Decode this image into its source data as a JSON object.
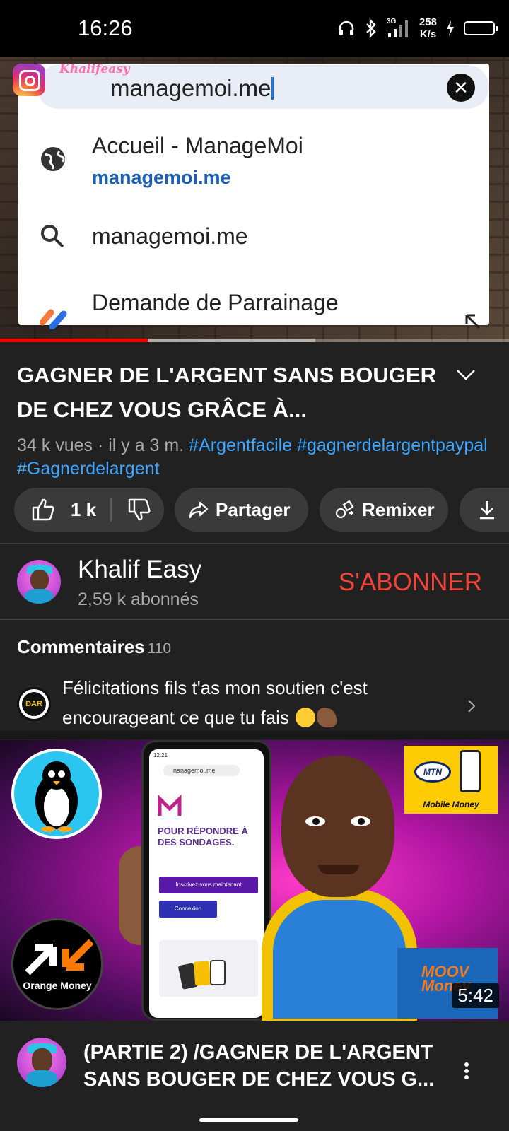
{
  "status_bar": {
    "time": "16:26",
    "network": "3G",
    "speed_value": "258",
    "speed_unit": "K/s",
    "icons": [
      "headphones-icon",
      "bluetooth-icon",
      "signal-icon",
      "charging-icon",
      "battery-icon"
    ]
  },
  "player": {
    "watermark": "Khalifeasy",
    "url_text": "managemoi.me",
    "suggestions": [
      {
        "icon": "globe-icon",
        "title": "Accueil - ManageMoi",
        "url": "managemoi.me"
      },
      {
        "icon": "search-icon",
        "title": "managemoi.me"
      },
      {
        "icon": "app-icon",
        "title": "Demande de Parrainage"
      }
    ],
    "progress_fraction": 0.29,
    "buffer_fraction": 0.62
  },
  "video": {
    "title": "GAGNER DE L'ARGENT SANS BOUGER DE CHEZ VOUS GRÂCE À...",
    "views": "34 k vues",
    "age": "il y a 3 m.",
    "hashtags": [
      "#Argentfacile",
      "#gagnerdelargentpaypal",
      "#Gagnerdelargent"
    ]
  },
  "actions": {
    "like_count": "1 k",
    "share_label": "Partager",
    "remix_label": "Remixer"
  },
  "channel": {
    "name": "Khalif Easy",
    "subscribers": "2,59 k abonnés",
    "subscribe_label": "S'ABONNER"
  },
  "comments": {
    "header": "Commentaires",
    "count": "110",
    "author_badge": "DAR",
    "top_comment": "Félicitations fils t'as mon soutien c'est encourageant ce que tu fais"
  },
  "next_video": {
    "duration": "5:42",
    "title": "(PARTIE 2) /GAGNER DE L'ARGENT SANS BOUGER DE CHEZ VOUS G...",
    "thumbnail_text": {
      "phone_time": "12:21",
      "phone_url": "nanagemoi.me",
      "phone_heading": "POUR RÉPONDRE À DES SONDAGES.",
      "btn_register": "Inscrivez-vous maintenant",
      "btn_login": "Connexion",
      "orange_money": "Orange Money",
      "mtn": "MTN",
      "mobile_money": "Mobile Money",
      "moov_money": "MOOV Money"
    }
  },
  "colors": {
    "background": "#212121",
    "accent_red": "#f44336",
    "link_blue": "#3ea6ff",
    "pill_bg": "#3a3a3a",
    "progress_red": "#ff0000"
  }
}
